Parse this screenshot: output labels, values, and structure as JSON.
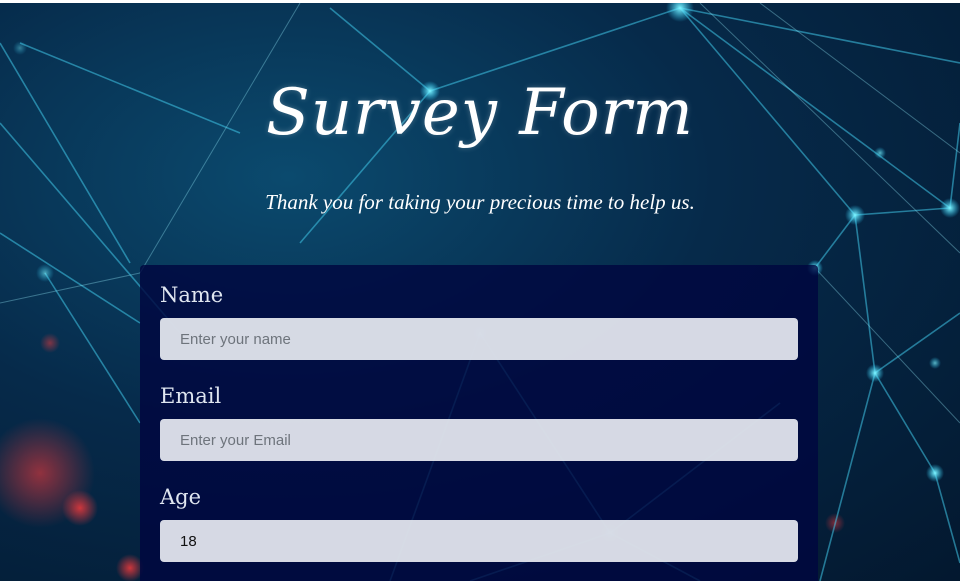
{
  "header": {
    "title": "Survey Form",
    "subtitle": "Thank you for taking your precious time to help us."
  },
  "form": {
    "name": {
      "label": "Name",
      "placeholder": "Enter your name"
    },
    "email": {
      "label": "Email",
      "placeholder": "Enter your Email"
    },
    "age": {
      "label": "Age",
      "value": "18"
    }
  }
}
